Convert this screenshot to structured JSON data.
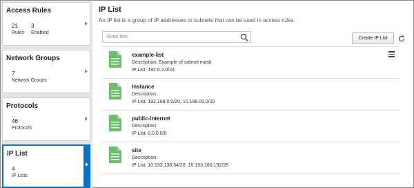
{
  "sidebar": {
    "cards": [
      {
        "title": "Access Rules",
        "stats": [
          {
            "value": "21",
            "label": "Rules"
          },
          {
            "value": "3",
            "label": "Enabled"
          }
        ]
      },
      {
        "title": "Network Groups",
        "stats": [
          {
            "value": "7",
            "label": "Network Groups"
          }
        ]
      },
      {
        "title": "Protocols",
        "stats": [
          {
            "value": "46",
            "label": "Protocols"
          }
        ]
      },
      {
        "title": "IP List",
        "stats": [
          {
            "value": "4",
            "label": "IP Lists"
          }
        ],
        "selected": true
      }
    ],
    "accent": "#0572ce"
  },
  "main": {
    "title": "IP List",
    "description": "An IP list is a group of IP addresses or subnets that can be used in access rules.",
    "search": {
      "placeholder": "Enter text",
      "value": ""
    },
    "create_button": "Create IP List",
    "items": [
      {
        "name": "example-list",
        "description": "Description: Example of subnet mask",
        "ip_list": "IP List: 192.0.2.0/24"
      },
      {
        "name": "Instance",
        "description": "Description:",
        "ip_list": "IP List: 192.168.0.0/20, 10.198.00.0/20"
      },
      {
        "name": "public-internet",
        "description": "Description:",
        "ip_list": "IP List: 0.0.0.0/0"
      },
      {
        "name": "site",
        "description": "Description:",
        "ip_list": "IP List: 10.193.138.64/26, 10.193.180.192/28"
      }
    ],
    "icon_color": "#6abf69"
  },
  "icons": [
    "search-icon",
    "refresh-icon",
    "document-icon",
    "menu-icon",
    "chevron-right-icon"
  ]
}
